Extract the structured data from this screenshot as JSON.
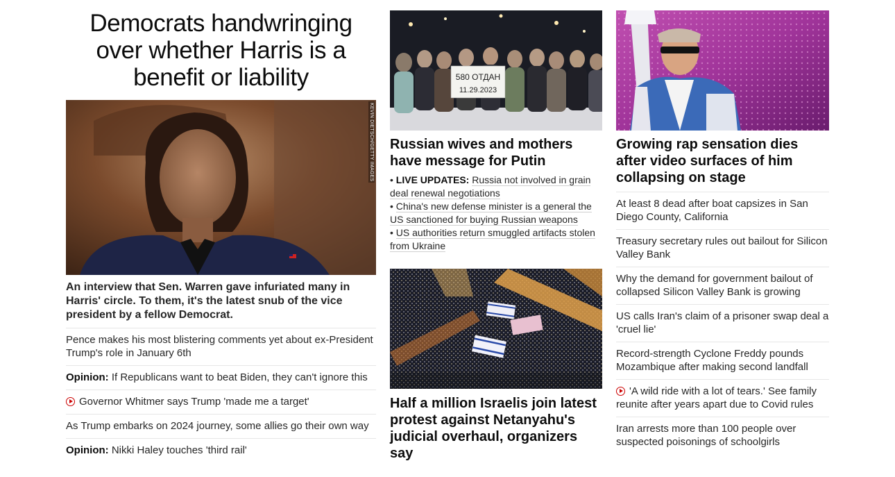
{
  "lead": {
    "headline": "Democrats handwringing over whether Harris is a benefit or liability",
    "photo_credit": "KEVIN DIETSCH/GETTY IMAGES",
    "description": "An interview that Sen. Warren gave infuriated many in Harris' circle. To them, it's the latest snub of the vice president by a fellow Democrat.",
    "related": [
      {
        "prefix": "",
        "text": "Pence makes his most blistering comments yet about ex-President Trump's role in January 6th",
        "video": false
      },
      {
        "prefix": "Opinion:",
        "text": "If Republicans want to beat Biden, they can't ignore this",
        "video": false
      },
      {
        "prefix": "",
        "text": "Governor Whitmer says Trump 'made me a target'",
        "video": true
      },
      {
        "prefix": "",
        "text": "As Trump embarks on 2024 journey, some allies go their own way",
        "video": false
      },
      {
        "prefix": "Opinion:",
        "text": "Nikki Haley touches 'third rail'",
        "video": false
      }
    ]
  },
  "russia": {
    "headline": "Russian wives and mothers have message for Putin",
    "sign_text_1": "580 ОТДАН",
    "sign_text_2": "11.29.2023",
    "bullets": [
      {
        "prefix": "LIVE UPDATES:",
        "text": "Russia not involved in grain deal renewal negotiations"
      },
      {
        "prefix": "",
        "text": "China's new defense minister is a general the US sanctioned for buying Russian weapons"
      },
      {
        "prefix": "",
        "text": "US authorities return smuggled artifacts stolen from Ukraine"
      }
    ]
  },
  "israel": {
    "headline": "Half a million Israelis join latest protest against Netanyahu's judicial overhaul, organizers say"
  },
  "rap": {
    "headline": "Growing rap sensation dies after video surfaces of him collapsing on stage",
    "related": [
      {
        "text": "At least 8 dead after boat capsizes in San Diego County, California",
        "video": false
      },
      {
        "text": "Treasury secretary rules out bailout for Silicon Valley Bank",
        "video": false
      },
      {
        "text": "Why the demand for government bailout of collapsed Silicon Valley Bank is growing",
        "video": false
      },
      {
        "text": "US calls Iran's claim of a prisoner swap deal a 'cruel lie'",
        "video": false
      },
      {
        "text": "Record-strength Cyclone Freddy pounds Mozambique after making second landfall",
        "video": false
      },
      {
        "text": "'A wild ride with a lot of tears.' See family reunite after years apart due to Covid rules",
        "video": true
      },
      {
        "text": "Iran arrests more than 100 people over suspected poisonings of schoolgirls",
        "video": false
      }
    ]
  },
  "colors": {
    "video_red": "#cc0000",
    "text": "#0c0c0c",
    "divider": "#e6e6e6"
  }
}
